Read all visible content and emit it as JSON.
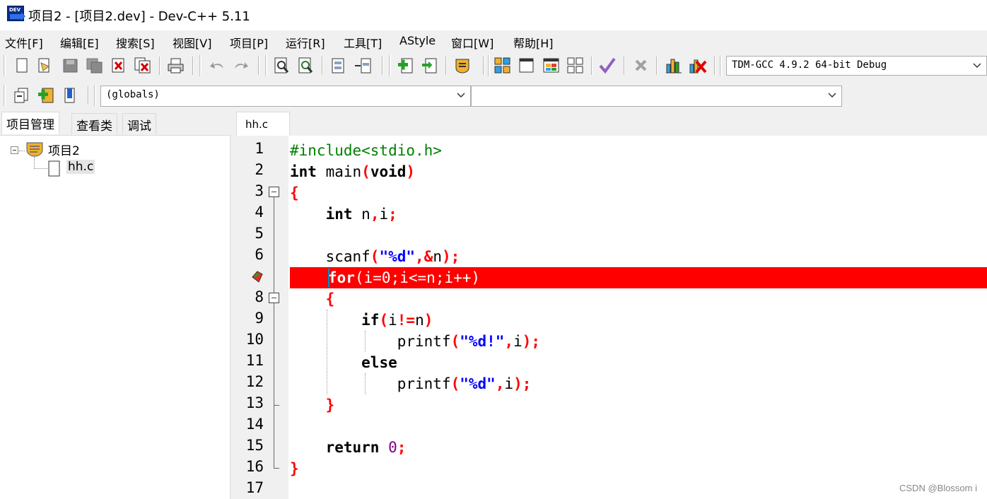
{
  "window": {
    "title": "项目2 - [项目2.dev] - Dev-C++ 5.11",
    "icon": "devcpp-app-icon"
  },
  "menu": [
    "文件[F]",
    "编辑[E]",
    "搜索[S]",
    "视图[V]",
    "项目[P]",
    "运行[R]",
    "工具[T]",
    "AStyle",
    "窗口[W]",
    "帮助[H]"
  ],
  "toolbar": {
    "compiler_select": "TDM-GCC 4.9.2 64-bit Debug",
    "globals_select": "(globals)",
    "members_select": ""
  },
  "left_panel": {
    "tabs": [
      "项目管理",
      "查看类",
      "调试"
    ],
    "active_tab": 0,
    "tree": {
      "project": "项目2",
      "files": [
        "hh.c"
      ]
    }
  },
  "editor": {
    "tab": "hh.c",
    "line_numbers": [
      "1",
      "2",
      "3",
      "4",
      "5",
      "6",
      "",
      "8",
      "9",
      "10",
      "11",
      "12",
      "13",
      "14",
      "15",
      "16",
      "17"
    ],
    "breakpoint_line": 7,
    "highlight_color": "#ff0000",
    "lines": {
      "l1": {
        "pp": "#include<stdio.h>"
      },
      "l2": {
        "a": "int",
        "b": " main",
        "c": "(",
        "d": "void",
        "e": ")"
      },
      "l3": {
        "a": "{"
      },
      "l4": {
        "a": "    ",
        "b": "int",
        "c": " n",
        "d": ",",
        "e": "i",
        "f": ";"
      },
      "l6": {
        "a": "    scanf",
        "b": "(",
        "c": "\"%d\"",
        "d": ",&",
        "e": "n",
        "f": ");"
      },
      "l7": {
        "a": "for",
        "b": "(",
        "c": "i",
        "d": "=",
        "e": "0",
        "f": ";",
        "g": "i",
        "h": "<=",
        "i": "n",
        "j": ";",
        "k": "i",
        "l": "++)"
      },
      "l8": {
        "a": "    {"
      },
      "l9": {
        "a": "        ",
        "b": "if",
        "c": "(",
        "d": "i",
        "e": "!=",
        "f": "n",
        "g": ")"
      },
      "l10": {
        "a": "            printf",
        "b": "(",
        "c": "\"%d!\"",
        "d": ",",
        "e": "i",
        "f": ");"
      },
      "l11": {
        "a": "        ",
        "b": "else"
      },
      "l12": {
        "a": "            printf",
        "b": "(",
        "c": "\"%d\"",
        "d": ",",
        "e": "i",
        "f": ");"
      },
      "l13": {
        "a": "    }"
      },
      "l15": {
        "a": "    ",
        "b": "return",
        "c": " ",
        "d": "0",
        "e": ";"
      },
      "l16": {
        "a": "}"
      }
    }
  },
  "watermark": "CSDN @Blossom i"
}
